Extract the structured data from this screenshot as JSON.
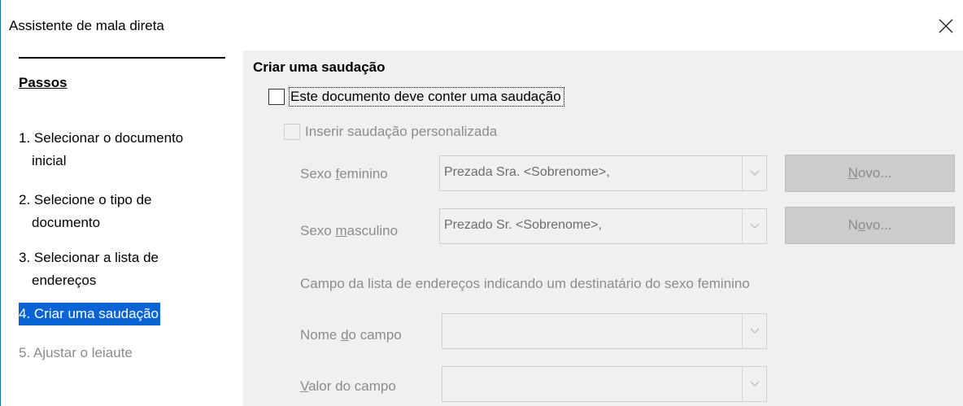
{
  "window": {
    "title": "Assistente de mala direta"
  },
  "sidebar": {
    "heading": "Passos",
    "steps": [
      {
        "line1": "1. Selecionar o documento",
        "line2": "inicial"
      },
      {
        "line1": "2. Selecione o tipo de",
        "line2": "documento"
      },
      {
        "line1": "3. Selecionar a lista de",
        "line2": "endereços"
      },
      {
        "line1": "4. Criar uma saudação"
      },
      {
        "line1": "5. Ajustar o leiaute"
      }
    ]
  },
  "content": {
    "section_title": "Criar uma saudação",
    "contain_greeting": {
      "label": "Este documento deve conter uma saudação",
      "checked": false
    },
    "personalized": {
      "label": "Inserir saudação personalizada",
      "checked": false,
      "enabled": false
    },
    "female": {
      "label_pre": "Sexo ",
      "label_u": "f",
      "label_post": "eminino",
      "value": "Prezada Sra. <Sobrenome>,",
      "button": {
        "pre": "",
        "u": "N",
        "post": "ovo..."
      }
    },
    "male": {
      "label_pre": "Sexo ",
      "label_u": "m",
      "label_post": "asculino",
      "value": "Prezado Sr. <Sobrenome>,",
      "button": {
        "pre": "N",
        "u": "o",
        "post": "vo..."
      }
    },
    "field_caption": "Campo da lista de endereços indicando um destinatário do sexo feminino",
    "field_name": {
      "label_pre": "Nome ",
      "label_u": "d",
      "label_post": "o campo",
      "value": ""
    },
    "field_value": {
      "label_pre": "",
      "label_u": "V",
      "label_post": "alor do campo",
      "value": ""
    }
  }
}
